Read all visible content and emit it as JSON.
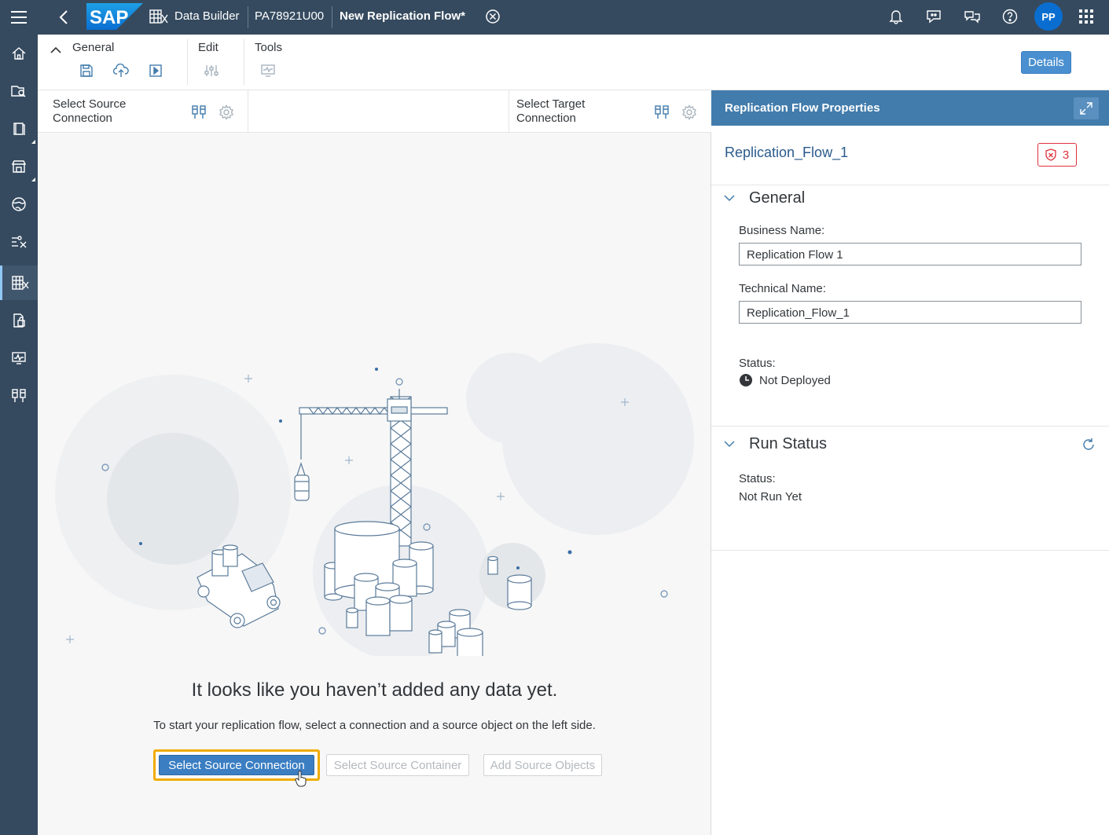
{
  "shell": {
    "logo_text": "SAP",
    "app_title": "Data Builder",
    "space_id": "PA78921U00",
    "doc_title": "New Replication Flow*",
    "avatar_initials": "PP"
  },
  "leftnav": {
    "items": [
      {
        "icon": "home-icon"
      },
      {
        "icon": "catalog-search-icon"
      },
      {
        "icon": "repository-icon"
      },
      {
        "icon": "marketplace-icon"
      },
      {
        "icon": "globe-icon"
      },
      {
        "icon": "data-integration-icon"
      },
      {
        "icon": "data-builder-icon",
        "active": true
      },
      {
        "icon": "security-icon"
      },
      {
        "icon": "monitor-icon"
      },
      {
        "icon": "connections-icon"
      }
    ]
  },
  "toolbar": {
    "general_label": "General",
    "edit_label": "Edit",
    "tools_label": "Tools",
    "details_label": "Details"
  },
  "connections": {
    "source_label": "Select Source Connection",
    "target_label": "Select Target Connection"
  },
  "empty_state": {
    "title": "It looks like you haven’t added any data yet.",
    "description": "To start your replication flow, select a connection and a source object on the left side.",
    "primary_button": "Select Source Connection",
    "container_button": "Select Source Container",
    "objects_button": "Add Source Objects"
  },
  "panel": {
    "title": "Replication Flow Properties",
    "object_name": "Replication_Flow_1",
    "error_count": "3",
    "general": {
      "title": "General",
      "business_name_label": "Business Name:",
      "business_name_value": "Replication Flow 1",
      "technical_name_label": "Technical Name:",
      "technical_name_value": "Replication_Flow_1",
      "status_label": "Status:",
      "status_value": "Not Deployed"
    },
    "run_status": {
      "title": "Run Status",
      "status_label": "Status:",
      "status_value": "Not Run Yet"
    }
  },
  "colors": {
    "shell": "#354a5f",
    "accent": "#427cac",
    "highlight": "#f0ab00",
    "error": "#e0303d"
  }
}
